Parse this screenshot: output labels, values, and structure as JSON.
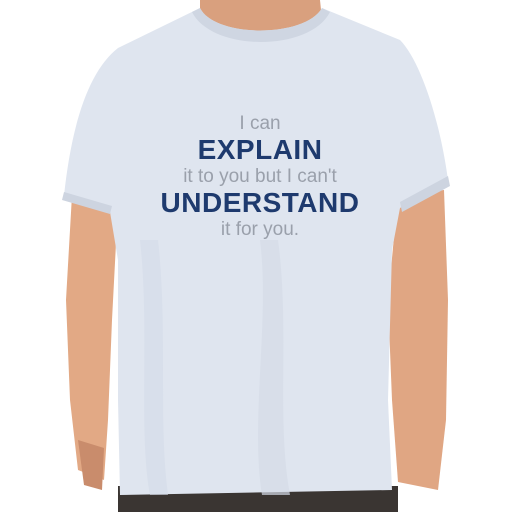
{
  "shirt": {
    "color": "#dfe5ef",
    "print_lines": [
      {
        "text": "I can",
        "style": "small"
      },
      {
        "text": "EXPLAIN",
        "style": "big"
      },
      {
        "text": "it to you but I can't",
        "style": "small"
      },
      {
        "text": "UNDERSTAND",
        "style": "big"
      },
      {
        "text": "it for you.",
        "style": "small"
      }
    ],
    "colors": {
      "small_text": "#9aa0ab",
      "big_text": "#1e3a6e"
    }
  }
}
